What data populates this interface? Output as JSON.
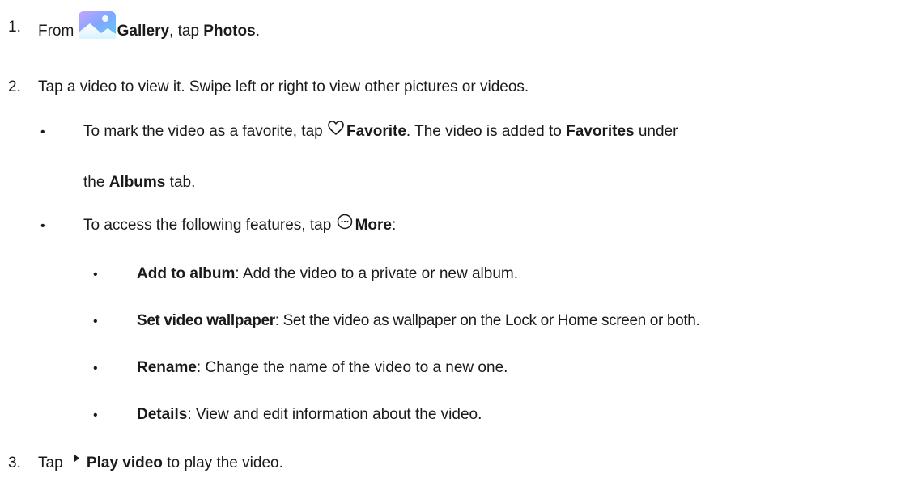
{
  "steps": [
    {
      "number": "1.",
      "prefix": "From ",
      "icon": "gallery-app-icon",
      "bold1": "Gallery",
      "mid": ", tap ",
      "bold2": "Photos",
      "suffix": "."
    },
    {
      "number": "2.",
      "text": "Tap a video to view it. Swipe left or right to view other pictures or videos.",
      "bullets": [
        {
          "prefix": "To mark the video as a favorite, tap ",
          "icon": "heart-icon",
          "bold1": "Favorite",
          "mid": ". The video is added to ",
          "bold2": "Favorites",
          "suffix": " under",
          "line2_prefix": "the ",
          "line2_bold": "Albums",
          "line2_suffix": " tab."
        },
        {
          "prefix": "To access the following features, tap ",
          "icon": "more-icon",
          "bold1": "More",
          "suffix": ":",
          "subbullets": [
            {
              "bold": "Add to album",
              "text": ": Add the video to a private or new album."
            },
            {
              "bold": "Set video wallpaper",
              "text": ": Set the video as wallpaper on the Lock or Home screen or both."
            },
            {
              "bold": "Rename",
              "text": ": Change the name of the video to a new one."
            },
            {
              "bold": "Details",
              "text": ": View and edit information about the video."
            }
          ]
        }
      ]
    },
    {
      "number": "3.",
      "prefix": "Tap ",
      "icon": "play-icon",
      "bold1": "Play video",
      "suffix": " to play the video."
    }
  ],
  "bullet_char": "•"
}
